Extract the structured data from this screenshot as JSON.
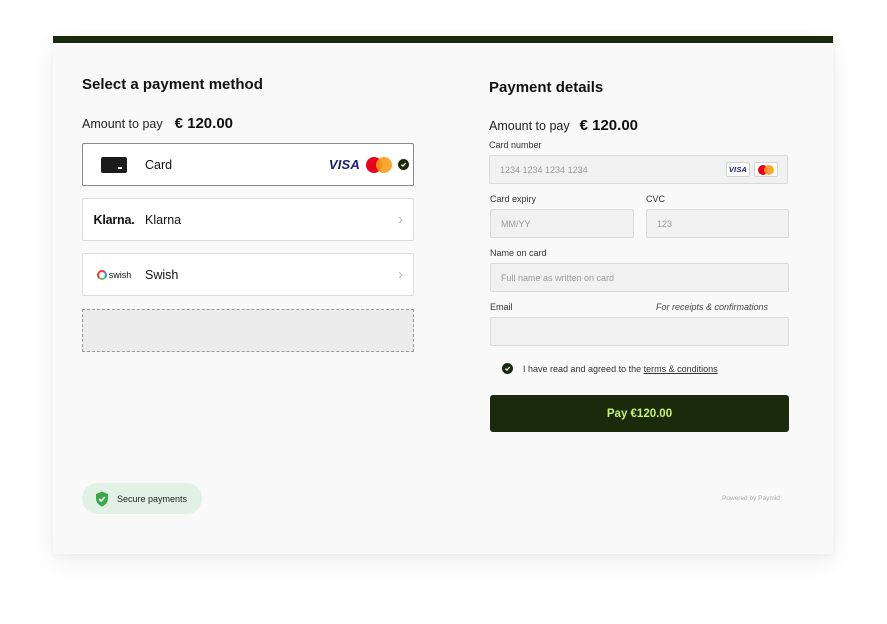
{
  "left": {
    "title": "Select a payment method",
    "amount_label": "Amount to pay",
    "amount_value": "€ 120.00",
    "methods": [
      {
        "label": "Card",
        "icon": "credit-card-icon",
        "brand_visa": "VISA",
        "selected": true
      },
      {
        "label": "Klarna",
        "logo_text": "Klarna.",
        "icon": "chevron-right-icon"
      },
      {
        "label": "Swish",
        "logo_text": "swish",
        "icon": "chevron-right-icon"
      }
    ],
    "secure_label": "Secure payments"
  },
  "right": {
    "title": "Payment details",
    "amount_label": "Amount to pay",
    "amount_value": "€ 120.00",
    "card_number": {
      "label": "Card number",
      "placeholder": "1234 1234 1234 1234",
      "visa": "VISA"
    },
    "expiry": {
      "label": "Card expiry",
      "placeholder": "MM/YY"
    },
    "cvc": {
      "label": "CVC",
      "placeholder": "123"
    },
    "name": {
      "label": "Name on card",
      "placeholder": "Full name as written on card"
    },
    "email": {
      "label": "Email",
      "hint": "For receipts & confirmations",
      "placeholder": ""
    },
    "terms": {
      "prefix": "I have read and agreed to the",
      "link": "terms & conditions"
    },
    "pay_label": "Pay €120.00",
    "powered_by": "Powered by Paymid"
  },
  "colors": {
    "brand_dark": "#1b2a0a",
    "pay_text": "#c7f27a",
    "secure_bg": "#e2f1e6",
    "shield": "#3aa84b"
  }
}
